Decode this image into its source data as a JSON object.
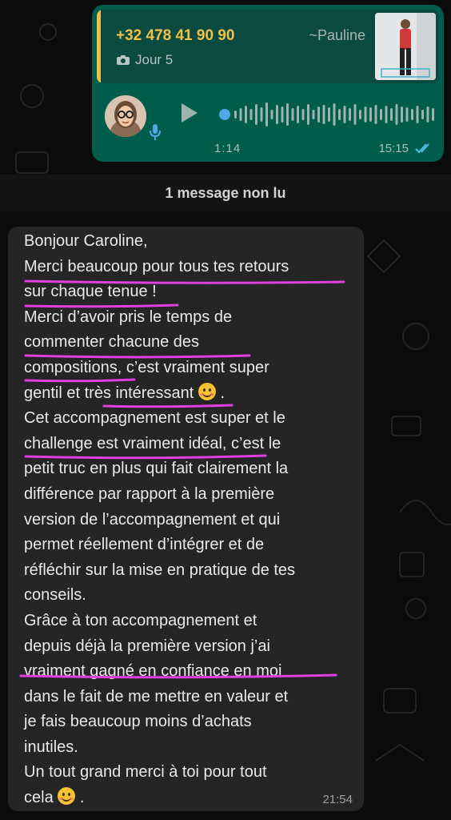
{
  "voice_message": {
    "quote": {
      "phone": "+32 478 41 90 90",
      "name": "~Pauline",
      "subtitle": "Jour 5"
    },
    "duration": "1:14",
    "time": "15:15"
  },
  "unread_divider": "1 message non lu",
  "text_message": {
    "lines": [
      "Bonjour Caroline,",
      "Merci beaucoup pour tous tes retours",
      "sur chaque tenue !",
      "Merci d’avoir pris le temps de",
      "commenter chacune des",
      "compositions, c’est vraiment super",
      "gentil et très intéressant",
      "Cet accompagnement est super et le",
      "challenge est vraiment idéal, c’est le",
      "petit truc en plus qui fait clairement la",
      "différence par rapport à la première",
      "version de l’accompagnement et qui",
      "permet réellement d’intégrer et de",
      "réfléchir sur la mise en pratique de tes",
      "conseils.",
      "Grâce à ton accompagnement et",
      "depuis déjà la première version j’ai",
      "vraiment gagné en confiance en moi",
      "dans le fait de me mettre en valeur et",
      "je fais beaucoup moins d’achats",
      "inutiles.",
      "Un tout grand merci à toi pour tout",
      "cela"
    ],
    "time": "21:54"
  },
  "colors": {
    "outgoing_bubble": "#005c4b",
    "incoming_bubble": "#252525",
    "quote_accent": "#f0c04a",
    "annotation_underline": "#e040e0",
    "read_ticks": "#53bdeb"
  },
  "icons": [
    "camera-icon",
    "microphone-icon",
    "play-icon",
    "double-check-icon",
    "smiling-emoji"
  ]
}
